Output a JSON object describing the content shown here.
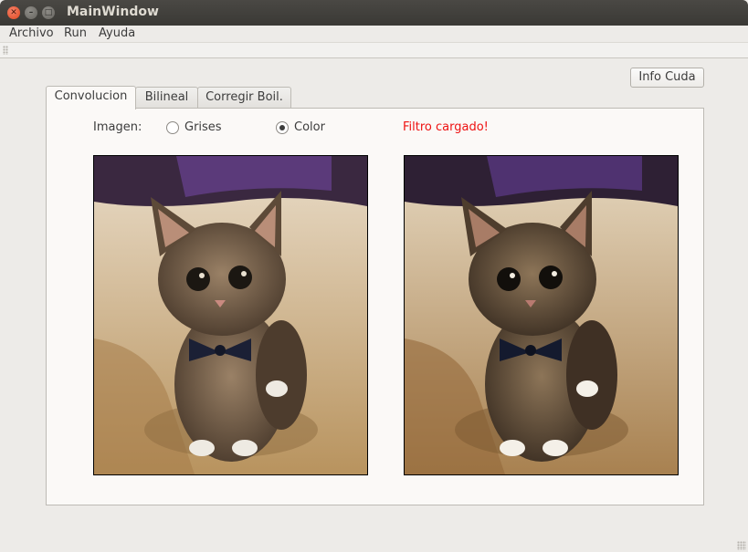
{
  "window": {
    "title": "MainWindow"
  },
  "menu": {
    "items": [
      "Archivo",
      "Run",
      "Ayuda"
    ]
  },
  "toolbar": {
    "info_button": "Info Cuda"
  },
  "tabs": [
    {
      "label": "Convolucion",
      "active": true
    },
    {
      "label": "Bilineal",
      "active": false
    },
    {
      "label": "Corregir Boil.",
      "active": false
    }
  ],
  "controls": {
    "image_label": "Imagen:",
    "radio_options": [
      {
        "label": "Grises",
        "checked": false
      },
      {
        "label": "Color",
        "checked": true
      }
    ],
    "status": "Filtro cargado!",
    "status_color": "#ee1111"
  },
  "images": {
    "original": {
      "description_icon": "kitten-photo"
    },
    "filtered": {
      "description_icon": "kitten-photo-filtered"
    }
  }
}
